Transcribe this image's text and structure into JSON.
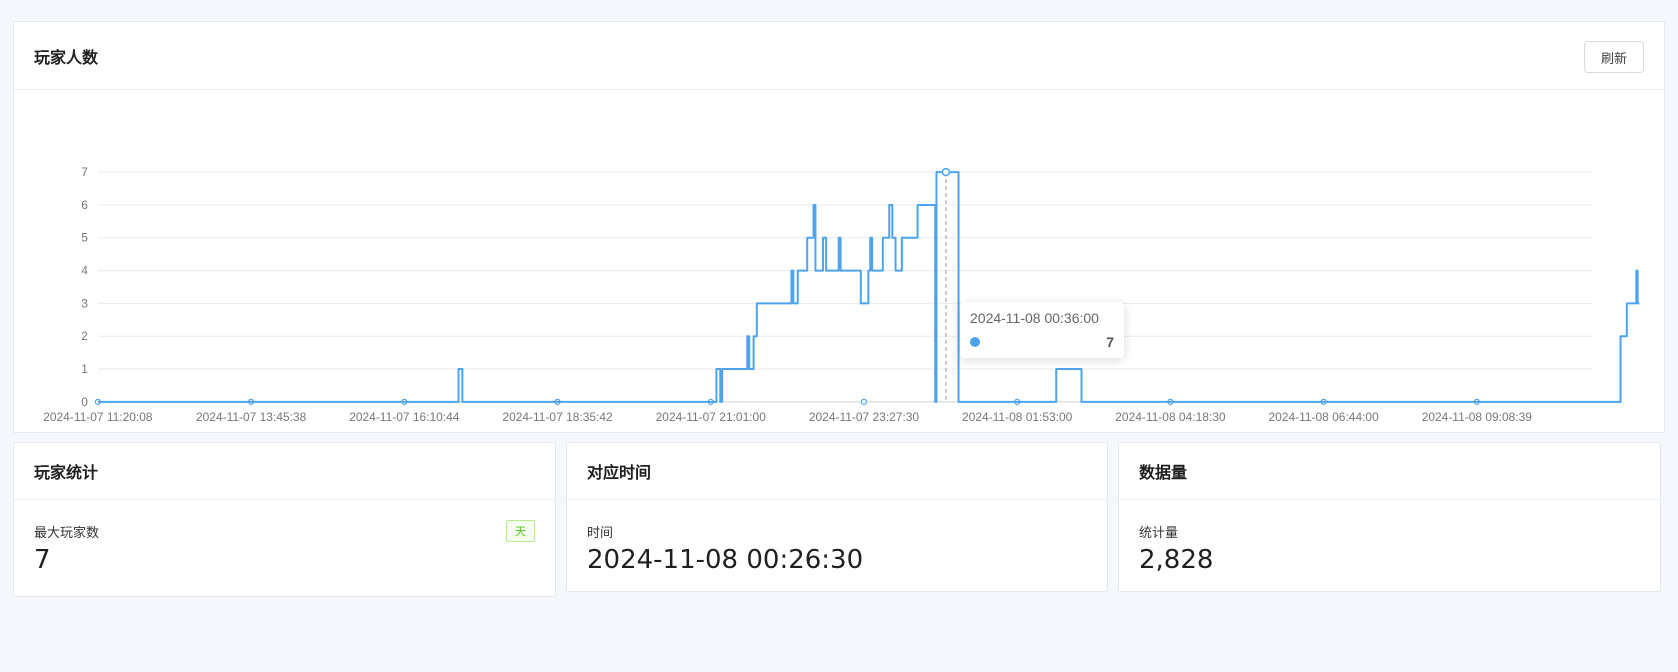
{
  "main_card": {
    "title": "玩家人数",
    "refresh_label": "刷新"
  },
  "chart_data": {
    "type": "line",
    "step": true,
    "color": "#4da3f0",
    "ylim": [
      0,
      7
    ],
    "yticks": [
      0,
      1,
      2,
      3,
      4,
      5,
      6,
      7
    ],
    "x_tick_labels": [
      "2024-11-07 11:20:08",
      "2024-11-07 13:45:38",
      "2024-11-07 16:10:44",
      "2024-11-07 18:35:42",
      "2024-11-07 21:01:00",
      "2024-11-07 23:27:30",
      "2024-11-08 01:53:00",
      "2024-11-08 04:18:30",
      "2024-11-08 06:44:00",
      "2024-11-08 09:08:39"
    ],
    "x_range_hours": [
      0,
      24.3
    ],
    "series": [
      {
        "points": [
          [
            0,
            0
          ],
          [
            5.72,
            0
          ],
          [
            5.72,
            1
          ],
          [
            5.78,
            1
          ],
          [
            5.78,
            0
          ],
          [
            9.81,
            0
          ],
          [
            9.81,
            1
          ],
          [
            9.87,
            1
          ],
          [
            9.87,
            0
          ],
          [
            9.9,
            0
          ],
          [
            9.9,
            1
          ],
          [
            10.3,
            1
          ],
          [
            10.3,
            2
          ],
          [
            10.33,
            2
          ],
          [
            10.33,
            1
          ],
          [
            10.4,
            1
          ],
          [
            10.4,
            2
          ],
          [
            10.45,
            2
          ],
          [
            10.45,
            3
          ],
          [
            11.0,
            3
          ],
          [
            11.0,
            4
          ],
          [
            11.03,
            4
          ],
          [
            11.03,
            3
          ],
          [
            11.1,
            3
          ],
          [
            11.1,
            4
          ],
          [
            11.25,
            4
          ],
          [
            11.25,
            5
          ],
          [
            11.35,
            5
          ],
          [
            11.35,
            6
          ],
          [
            11.38,
            6
          ],
          [
            11.38,
            4
          ],
          [
            11.5,
            4
          ],
          [
            11.5,
            5
          ],
          [
            11.55,
            5
          ],
          [
            11.55,
            4
          ],
          [
            11.75,
            4
          ],
          [
            11.75,
            5
          ],
          [
            11.78,
            5
          ],
          [
            11.78,
            4
          ],
          [
            12.1,
            4
          ],
          [
            12.1,
            3
          ],
          [
            12.22,
            3
          ],
          [
            12.22,
            4
          ],
          [
            12.25,
            4
          ],
          [
            12.25,
            5
          ],
          [
            12.28,
            5
          ],
          [
            12.28,
            4
          ],
          [
            12.45,
            4
          ],
          [
            12.45,
            5
          ],
          [
            12.55,
            5
          ],
          [
            12.55,
            6
          ],
          [
            12.6,
            6
          ],
          [
            12.6,
            5
          ],
          [
            12.65,
            5
          ],
          [
            12.65,
            4
          ],
          [
            12.75,
            4
          ],
          [
            12.75,
            5
          ],
          [
            13.0,
            5
          ],
          [
            13.0,
            6
          ],
          [
            13.28,
            6
          ],
          [
            13.28,
            0
          ],
          [
            13.3,
            0
          ],
          [
            13.3,
            7
          ],
          [
            13.65,
            7
          ],
          [
            13.65,
            0
          ],
          [
            15.2,
            0
          ],
          [
            15.2,
            1
          ],
          [
            15.6,
            1
          ],
          [
            15.6,
            0
          ],
          [
            24.15,
            0
          ],
          [
            24.15,
            2
          ],
          [
            24.25,
            2
          ],
          [
            24.25,
            3
          ],
          [
            24.4,
            3
          ],
          [
            24.4,
            4
          ],
          [
            24.42,
            4
          ],
          [
            24.42,
            3
          ],
          [
            24.45,
            3
          ]
        ]
      }
    ],
    "hover_x": 13.45,
    "tooltip": {
      "time": "2024-11-08 00:36:00",
      "value": "7"
    }
  },
  "stats": {
    "players": {
      "title": "玩家统计",
      "label": "最大玩家数",
      "value": "7",
      "badge": "天"
    },
    "time": {
      "title": "对应时间",
      "label": "时间",
      "value": "2024-11-08 00:26:30"
    },
    "count": {
      "title": "数据量",
      "label": "统计量",
      "value": "2,828"
    }
  }
}
